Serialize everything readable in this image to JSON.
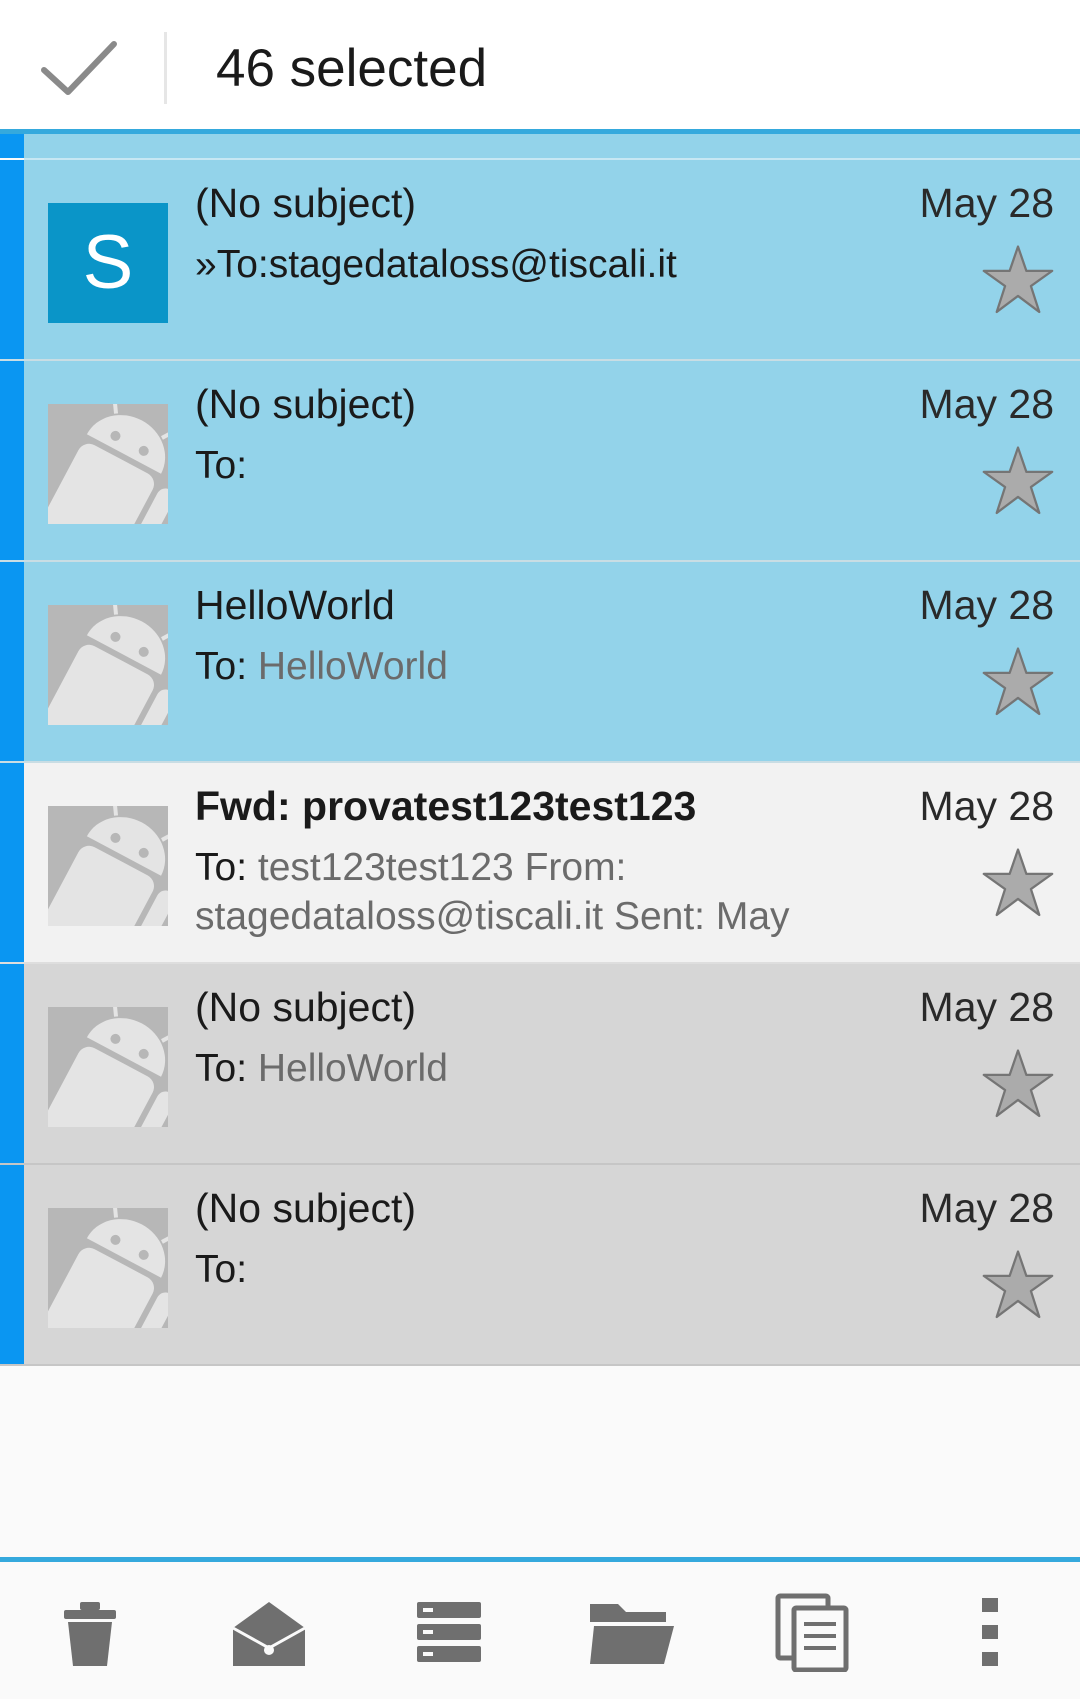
{
  "header": {
    "selected_count": "46 selected",
    "check_icon": "check-icon"
  },
  "messages": [
    {
      "subject": "(No subject)",
      "to_label": "»To:",
      "to_detail": "stagedataloss@tiscali.it",
      "date": "May 28",
      "avatar_letter": "S",
      "avatar_type": "letter",
      "state": "selected",
      "starred": false
    },
    {
      "subject": "(No subject)",
      "to_label": "To:",
      "to_detail": "",
      "date": "May 28",
      "avatar_type": "android",
      "state": "selected",
      "starred": false
    },
    {
      "subject": "HelloWorld",
      "to_label": "To: ",
      "to_detail": "HelloWorld",
      "date": "May 28",
      "avatar_type": "android",
      "state": "selected",
      "starred": false
    },
    {
      "subject": "Fwd: provatest123test123",
      "to_label": "To: ",
      "to_detail": "test123test123 From: stagedataloss@tiscali.it Sent: May",
      "date": "May 28",
      "avatar_type": "android",
      "state": "unread",
      "starred": false
    },
    {
      "subject": "(No subject)",
      "to_label": "To: ",
      "to_detail": "HelloWorld",
      "date": "May 28",
      "avatar_type": "android",
      "state": "gray",
      "starred": false
    },
    {
      "subject": "(No subject)",
      "to_label": "To:",
      "to_detail": "",
      "date": "May 28",
      "avatar_type": "android",
      "state": "gray",
      "starred": false
    }
  ],
  "bottom_actions": [
    "trash-icon",
    "mark-read-icon",
    "list-icon",
    "folder-icon",
    "copy-icon",
    "more-icon"
  ],
  "colors": {
    "accent": "#35a9dd",
    "selection_bar": "#0a96f2",
    "selected_row": "#93d3ea",
    "avatar_letter_bg": "#0a95c8"
  }
}
